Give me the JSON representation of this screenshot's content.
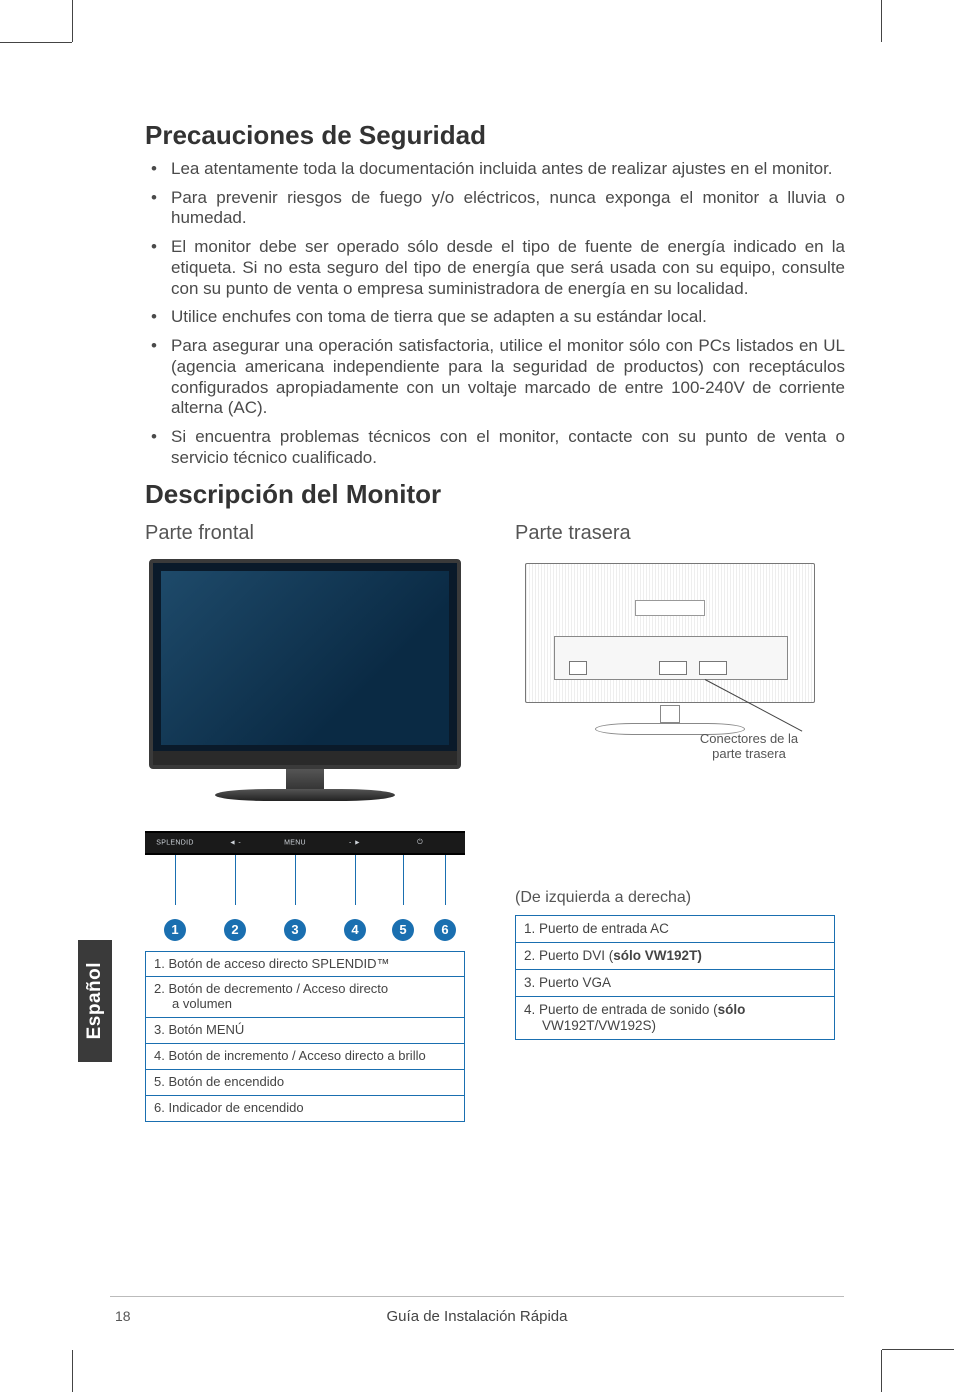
{
  "language_tab": "Español",
  "sections": {
    "safety_heading": "Precauciones de Seguridad",
    "bullets": [
      "Lea atentamente toda la documentación incluida antes de realizar ajustes en el monitor.",
      "Para prevenir riesgos de fuego y/o eléctricos, nunca exponga el monitor a lluvia o humedad.",
      "El monitor debe ser operado sólo desde el tipo de fuente de energía indicado en la etiqueta. Si no esta seguro del tipo de energía que será usada con su equipo, consulte con su punto de venta o empresa suministradora de energía en su localidad.",
      "Utilice enchufes con toma de tierra que se adapten a su estándar local.",
      "Para asegurar una operación satisfactoria, utilice el monitor sólo con PCs listados en UL (agencia americana independiente para la seguridad de productos) con receptáculos configurados apropiadamente con un voltaje marcado de entre 100-240V de corriente alterna (AC).",
      "Si encuentra problemas técnicos con el monitor, contacte con su punto de venta o servicio técnico cualificado."
    ],
    "desc_heading": "Descripción del Monitor"
  },
  "front": {
    "title": "Parte frontal",
    "button_labels": {
      "b1": "SPLENDID",
      "b2": "◄ -",
      "b3": "MENU",
      "b4": "- ►",
      "b5": "⏻"
    },
    "numbers": {
      "n1": "1",
      "n2": "2",
      "n3": "3",
      "n4": "4",
      "n5": "5",
      "n6": "6"
    },
    "legend": [
      "1. Botón de acceso directo SPLENDID™",
      "2. Botón de decremento / Acceso directo",
      "a volumen",
      "3. Botón MENÚ",
      "4. Botón de incremento / Acceso directo a brillo",
      "5. Botón de encendido",
      "6. Indicador de encendido"
    ]
  },
  "rear": {
    "title": "Parte trasera",
    "callout_l1": "Conectores de la",
    "callout_l2": "parte trasera",
    "subhead": "(De izquierda a derecha)",
    "legend": {
      "r1": "1. Puerto de entrada AC",
      "r2a": "2. Puerto DVI (",
      "r2b": "sólo VW192T)",
      "r3": "3. Puerto VGA",
      "r4a": "4. Puerto de entrada de sonido (",
      "r4b": "sólo",
      "r4c": "VW192T/VW192S)"
    }
  },
  "footer": {
    "page": "18",
    "title": "Guía de Instalación Rápida"
  }
}
